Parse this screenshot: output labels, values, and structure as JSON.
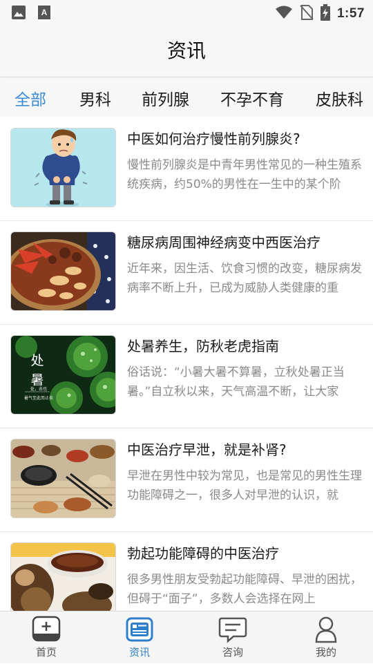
{
  "status_bar": {
    "time": "1:57",
    "icons": [
      "image-icon",
      "font-icon",
      "wifi-icon",
      "no-sim-icon",
      "battery-charging-icon"
    ]
  },
  "header": {
    "title": "资讯"
  },
  "tabs": [
    {
      "label": "全部",
      "active": true
    },
    {
      "label": "男科",
      "active": false
    },
    {
      "label": "前列腺",
      "active": false
    },
    {
      "label": "不孕不育",
      "active": false
    },
    {
      "label": "皮肤科",
      "active": false
    }
  ],
  "articles": [
    {
      "title": "中医如何治疗慢性前列腺炎?",
      "summary": "慢性前列腺炎是中青年男性常见的一种生殖系统疾病，约50%的男性在一生中的某个阶",
      "thumb_icon": "sick-man-illustration"
    },
    {
      "title": "糖尿病周围神经病变中西医治疗",
      "summary": "近年来，因生活、饮食习惯的改变，糖尿病发病率不断上升，已成为威胁人类健康的重",
      "thumb_icon": "herbal-medicine-photo"
    },
    {
      "title": "处暑养生，防秋老虎指南",
      "summary": "俗话说：“小暑大暑不算暑，立秋处暑正当暑。”自立秋以来，天气高温不断，让大家",
      "thumb_icon": "leaves-with-dew-photo",
      "thumb_text": "处暑",
      "thumb_caption": "处，去也",
      "thumb_subcaption": "暑气至此而止矣"
    },
    {
      "title": "中医治疗早泄，就是补肾?",
      "summary": "早泄在男性中较为常见，也是常见的男性生理功能障碍之一，很多人对早泄的认识，就",
      "thumb_icon": "herbs-table-photo"
    },
    {
      "title": "勃起功能障碍的中医治疗",
      "summary": "很多男性朋友受勃起功能障碍、早泄的困扰，但碍于“面子”，多数人会选择在网上",
      "thumb_icon": "herbal-tea-photo"
    }
  ],
  "bottom_nav": [
    {
      "label": "首页",
      "icon": "home-plus-icon",
      "active": false
    },
    {
      "label": "资讯",
      "icon": "news-icon",
      "active": true
    },
    {
      "label": "咨询",
      "icon": "chat-icon",
      "active": false
    },
    {
      "label": "我的",
      "icon": "person-icon",
      "active": false
    }
  ],
  "colors": {
    "accent": "#3d8ad6",
    "nav_active": "#2d7fce",
    "summary_gray": "#8a8a8a"
  }
}
